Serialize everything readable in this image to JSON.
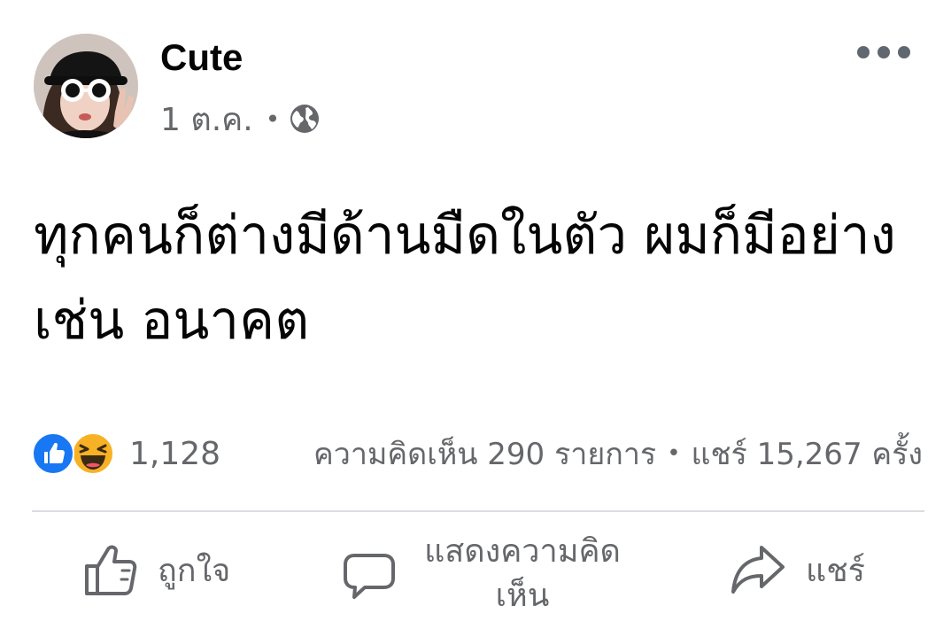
{
  "post": {
    "author": "Cute",
    "date": "1 ต.ค.",
    "meta_separator": "•",
    "privacy_icon": "globe-icon",
    "more_icon": "more-options-icon",
    "text": "ทุกคนก็ต่างมีด้านมืดในตัว ผมก็มีอย่างเช่น อนาคต"
  },
  "reactions": {
    "icons": [
      "like-icon",
      "haha-icon"
    ],
    "count": "1,128"
  },
  "stats": {
    "comments": "ความคิดเห็น 290 รายการ",
    "separator": "•",
    "shares": "แชร์ 15,267 ครั้ง"
  },
  "actions": {
    "like": "ถูกใจ",
    "comment": "แสดงความคิดเห็น",
    "share": "แชร์"
  },
  "colors": {
    "text_primary": "#050505",
    "text_secondary": "#65676b",
    "like_blue": "#1877f2",
    "haha_yellow": "#f7b125",
    "divider": "#dadde1"
  }
}
